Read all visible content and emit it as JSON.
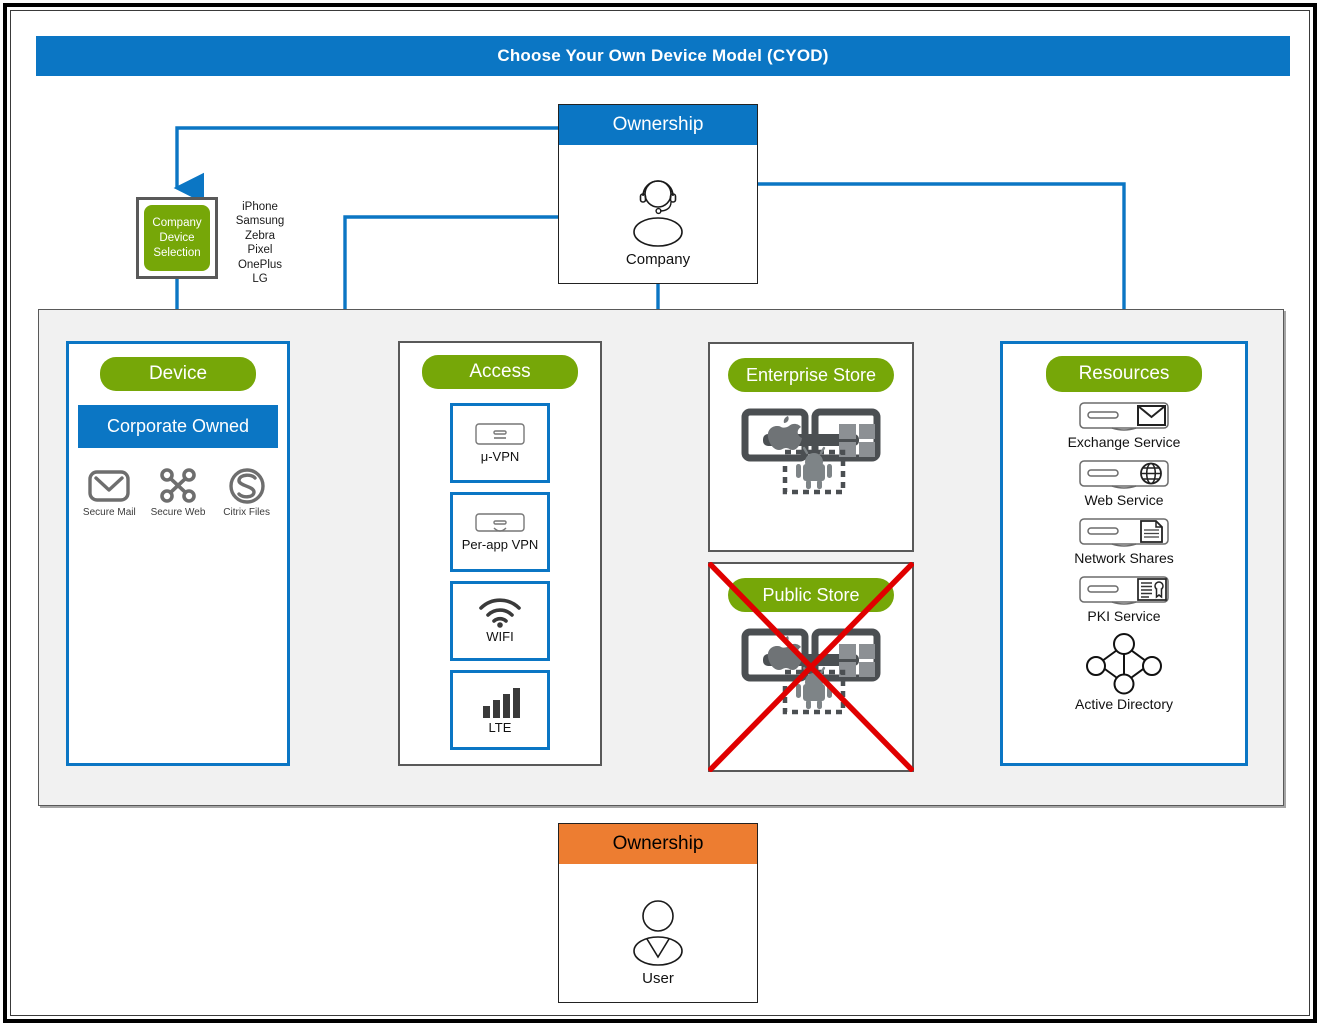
{
  "title": "Choose Your Own Device Model (CYOD)",
  "ownership_company": {
    "header": "Ownership",
    "label": "Company",
    "icon": "company-headset-avatar-icon",
    "header_color": "#0b76c4"
  },
  "ownership_user": {
    "header": "Ownership",
    "label": "User",
    "icon": "user-avatar-icon",
    "header_color": "#ed7d31"
  },
  "device_selection": {
    "label_line1": "Company",
    "label_line2": "Device",
    "label_line3": "Selection",
    "devices": [
      "iPhone",
      "Samsung",
      "Zebra",
      "Pixel",
      "OnePlus",
      "LG"
    ]
  },
  "device": {
    "title": "Device",
    "banner": "Corporate Owned",
    "apps": [
      {
        "label": "Secure Mail",
        "icon": "secure-mail-icon"
      },
      {
        "label": "Secure Web",
        "icon": "secure-web-icon"
      },
      {
        "label": "Citrix Files",
        "icon": "citrix-files-icon"
      }
    ]
  },
  "access": {
    "title": "Access",
    "items": [
      {
        "label": "μ-VPN",
        "icon": "vpn-tunnel-icon"
      },
      {
        "label": "Per-app VPN",
        "icon": "per-app-vpn-icon"
      },
      {
        "label": "WIFI",
        "icon": "wifi-icon"
      },
      {
        "label": "LTE",
        "icon": "lte-signal-bars-icon"
      }
    ]
  },
  "enterprise_store": {
    "title": "Enterprise Store",
    "icon": "app-store-platforms-icon",
    "blocked": false
  },
  "public_store": {
    "title": "Public Store",
    "icon": "app-store-platforms-icon",
    "blocked": true,
    "blocked_mark": "red-x-icon",
    "blocked_color": "#e00000"
  },
  "resources": {
    "title": "Resources",
    "items": [
      {
        "label": "Exchange Service",
        "icon": "server-mail-icon"
      },
      {
        "label": "Web Service",
        "icon": "server-globe-icon"
      },
      {
        "label": "Network Shares",
        "icon": "server-document-icon"
      },
      {
        "label": "PKI Service",
        "icon": "server-certificate-icon"
      },
      {
        "label": "Active Directory",
        "icon": "active-directory-nodes-icon"
      }
    ]
  },
  "colors": {
    "accent_blue": "#0b76c4",
    "green_pill": "#76a708",
    "orange": "#ed7d31",
    "panel_gray": "#f1f1f1",
    "border_gray": "#595959",
    "red": "#e00000"
  }
}
